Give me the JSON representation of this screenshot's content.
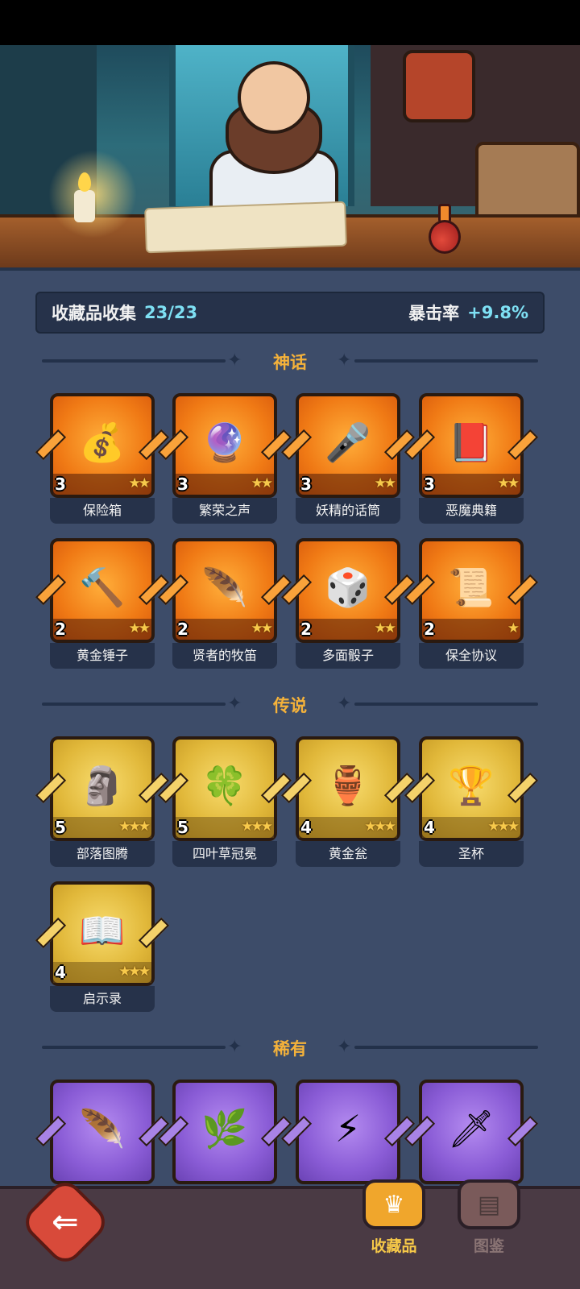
{
  "stats": {
    "collection_label": "收藏品收集",
    "collection_value": "23/23",
    "crit_label": "暴击率",
    "crit_value": "+9.8%"
  },
  "sections": {
    "mythic": "神话",
    "legend": "传说",
    "rare": "稀有"
  },
  "mythic_items": [
    {
      "name": "保险箱",
      "level": "3",
      "stars": "★★",
      "icon": "treasure-chest-icon",
      "glyph": "💰"
    },
    {
      "name": "繁荣之声",
      "level": "3",
      "stars": "★★",
      "icon": "blue-orb-icon",
      "glyph": "🔮"
    },
    {
      "name": "妖精的话筒",
      "level": "3",
      "stars": "★★",
      "icon": "fairy-microphone-icon",
      "glyph": "🎤"
    },
    {
      "name": "恶魔典籍",
      "level": "3",
      "stars": "★★",
      "icon": "demon-book-icon",
      "glyph": "📕"
    },
    {
      "name": "黄金锤子",
      "level": "2",
      "stars": "★★",
      "icon": "golden-hammer-icon",
      "glyph": "🔨"
    },
    {
      "name": "贤者的牧笛",
      "level": "2",
      "stars": "★★",
      "icon": "sage-flute-icon",
      "glyph": "🪶"
    },
    {
      "name": "多面骰子",
      "level": "2",
      "stars": "★★",
      "icon": "polyhedral-dice-icon",
      "glyph": "🎲"
    },
    {
      "name": "保全协议",
      "level": "2",
      "stars": "★",
      "icon": "contract-scroll-icon",
      "glyph": "📜"
    }
  ],
  "legend_items": [
    {
      "name": "部落图腾",
      "level": "5",
      "stars": "★★★",
      "icon": "tribal-totem-icon",
      "glyph": "🗿"
    },
    {
      "name": "四叶草冠冕",
      "level": "5",
      "stars": "★★★",
      "icon": "clover-crown-icon",
      "glyph": "🍀"
    },
    {
      "name": "黄金瓮",
      "level": "4",
      "stars": "★★★",
      "icon": "golden-urn-icon",
      "glyph": "🏺"
    },
    {
      "name": "圣杯",
      "level": "4",
      "stars": "★★★",
      "icon": "holy-grail-icon",
      "glyph": "🏆"
    },
    {
      "name": "启示录",
      "level": "4",
      "stars": "★★★",
      "icon": "open-book-icon",
      "glyph": "📖"
    }
  ],
  "rare_items": [
    {
      "icon": "phoenix-feather-icon",
      "glyph": "🪶"
    },
    {
      "icon": "thorn-vine-icon",
      "glyph": "🌿"
    },
    {
      "icon": "lightning-tome-icon",
      "glyph": "⚡"
    },
    {
      "icon": "ice-dagger-icon",
      "glyph": "🗡"
    }
  ],
  "nav": {
    "collection": "收藏品",
    "codex": "图鉴"
  },
  "colors": {
    "panel": "#3d4c69",
    "mythic": "#f07a15",
    "legend": "#e1b83a",
    "rare": "#8a5cd6",
    "section_title": "#f5b23a",
    "stat_value": "#7ee0f4"
  }
}
